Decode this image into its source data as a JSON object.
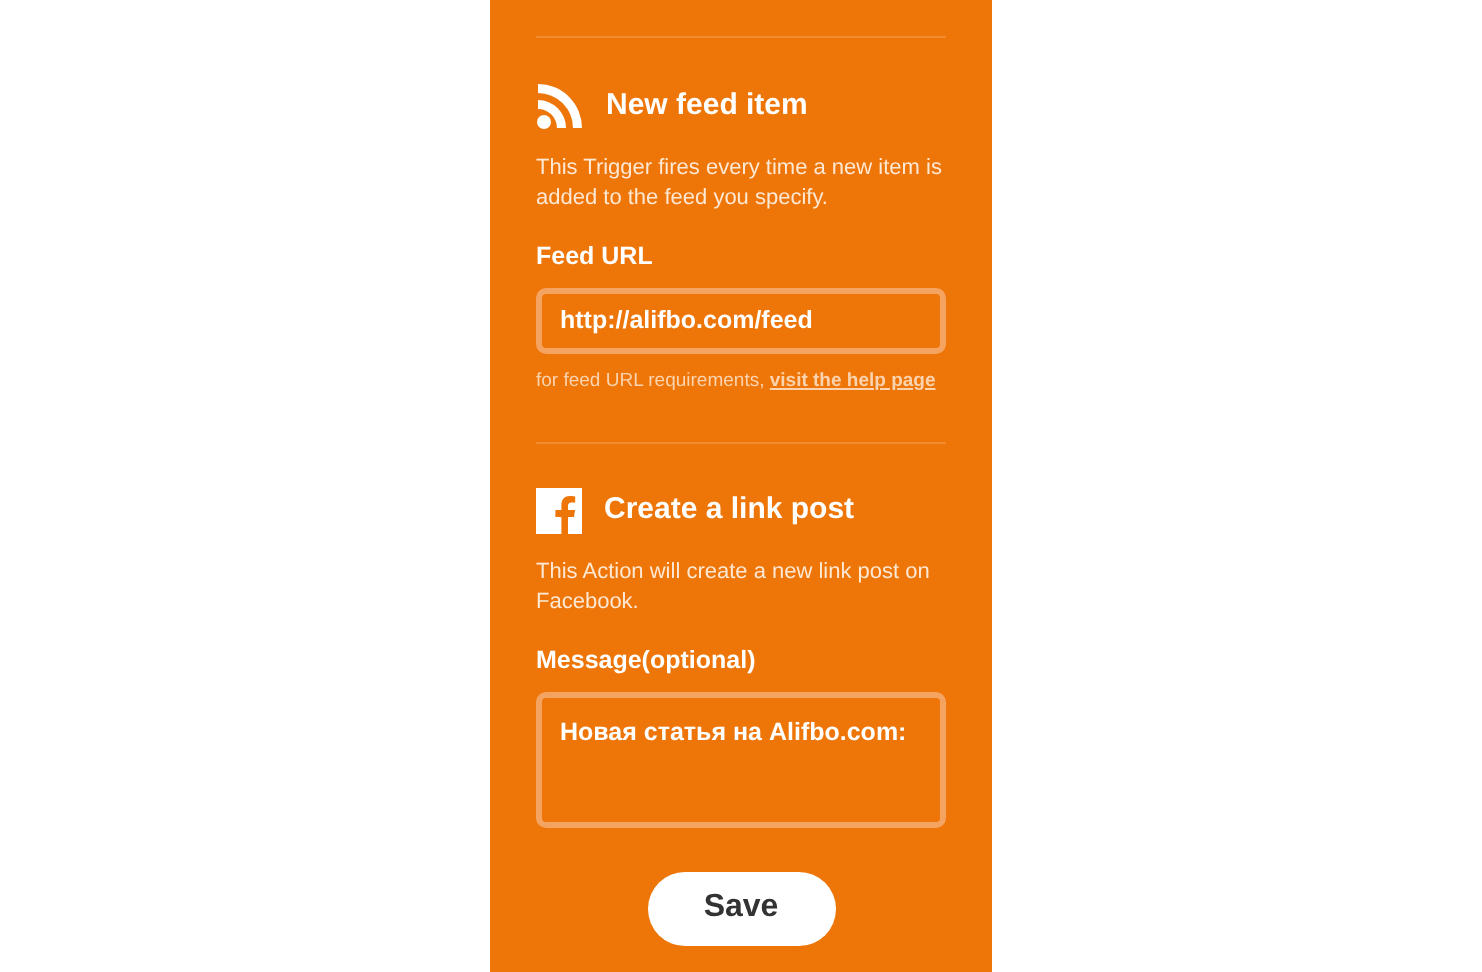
{
  "sections": [
    {
      "kind": "rss",
      "title": "New feed item",
      "description": "This Trigger fires every time a new item is added to the feed you specify.",
      "field": {
        "label": "Feed URL",
        "kind": "input",
        "value": "http://alifbo.com/feed"
      },
      "help": {
        "text": "for feed URL requirements,",
        "link": "visit the help page"
      }
    },
    {
      "kind": "facebook",
      "title": "Create a link post",
      "description": "This Action will create a new link post on Facebook.",
      "field": {
        "label": "Message(optional)",
        "kind": "textarea",
        "value": "Новая статья на Alifbo.com:"
      }
    }
  ],
  "save_button": "Save"
}
